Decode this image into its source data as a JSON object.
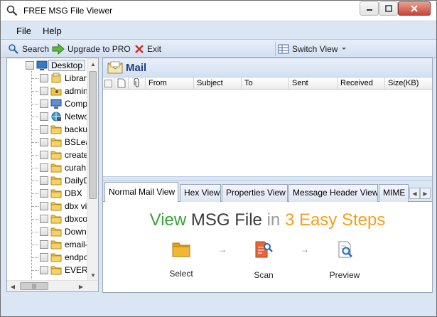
{
  "window": {
    "title": "FREE MSG File Viewer"
  },
  "menu": {
    "file": "File",
    "help": "Help"
  },
  "toolbar": {
    "search": "Search",
    "upgrade": "Upgrade to PRO",
    "exit": "Exit",
    "switch_view": "Switch View"
  },
  "tree": {
    "root": "Desktop",
    "items": [
      {
        "label": "Librar",
        "icon": "library-icon"
      },
      {
        "label": "admin",
        "icon": "user-folder-icon"
      },
      {
        "label": "Comp",
        "icon": "computer-icon"
      },
      {
        "label": "Netwo",
        "icon": "network-icon"
      },
      {
        "label": "backu",
        "icon": "folder-icon"
      },
      {
        "label": "BSLea",
        "icon": "folder-icon"
      },
      {
        "label": "create",
        "icon": "folder-icon"
      },
      {
        "label": "curah",
        "icon": "folder-icon"
      },
      {
        "label": "DailyD",
        "icon": "folder-icon"
      },
      {
        "label": "DBX",
        "icon": "folder-icon"
      },
      {
        "label": "dbx vi",
        "icon": "folder-icon"
      },
      {
        "label": "dbxco",
        "icon": "folder-icon"
      },
      {
        "label": "Down",
        "icon": "folder-icon"
      },
      {
        "label": "email-",
        "icon": "folder-icon"
      },
      {
        "label": "endpo",
        "icon": "folder-icon"
      },
      {
        "label": "EVERY",
        "icon": "folder-icon"
      }
    ],
    "hscroll_thumb": "|||"
  },
  "mail": {
    "title": "Mail",
    "columns": [
      "From",
      "Subject",
      "To",
      "Sent",
      "Received",
      "Size(KB)"
    ]
  },
  "tabs": [
    "Normal Mail View",
    "Hex View",
    "Properties View",
    "Message Header View",
    "MIME"
  ],
  "steps": {
    "title_part1": "View",
    "title_part2": "MSG File",
    "title_part3": "in",
    "title_part4": "3 Easy Steps",
    "items": [
      "Select",
      "Scan",
      "Preview"
    ],
    "arrow": "→"
  },
  "colors": {
    "accent": "#1f3f7a",
    "green": "#3aa23a",
    "orange": "#f0a21d",
    "chrome": "#dbe6f4"
  }
}
